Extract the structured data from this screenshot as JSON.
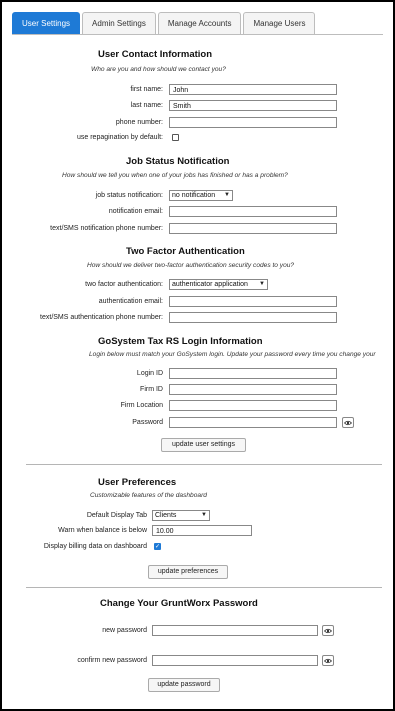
{
  "tabs": [
    {
      "label": "User Settings",
      "active": true
    },
    {
      "label": "Admin Settings",
      "active": false
    },
    {
      "label": "Manage Accounts",
      "active": false
    },
    {
      "label": "Manage Users",
      "active": false
    }
  ],
  "contact": {
    "title": "User Contact Information",
    "subtitle": "Who are you and how should we contact you?",
    "first_name_label": "first name:",
    "first_name_value": "John",
    "last_name_label": "last name:",
    "last_name_value": "Smith",
    "phone_label": "phone number:",
    "phone_value": "",
    "repagination_label": "use repagination by default:",
    "repagination_checked": false
  },
  "job_status": {
    "title": "Job Status Notification",
    "subtitle": "How should we tell you when one of your jobs has finished or has a problem?",
    "notification_label": "job status notification:",
    "notification_value": "no notification",
    "email_label": "notification email:",
    "email_value": "",
    "sms_label": "text/SMS notification phone number:",
    "sms_value": ""
  },
  "two_factor": {
    "title": "Two Factor Authentication",
    "subtitle": "How should we deliver two-factor authentication security codes to you?",
    "method_label": "two factor authentication:",
    "method_value": "authenticator application",
    "email_label": "authentication email:",
    "email_value": "",
    "sms_label": "text/SMS authentication phone number:",
    "sms_value": ""
  },
  "gosystem": {
    "title": "GoSystem Tax RS Login Information",
    "subtitle": "Login below must match your GoSystem login. Update your password every time you change your",
    "login_id_label": "Login ID",
    "firm_id_label": "Firm ID",
    "firm_location_label": "Firm Location",
    "password_label": "Password",
    "update_button": "update user settings"
  },
  "preferences": {
    "title": "User Preferences",
    "subtitle": "Customizable features of the dashboard",
    "display_tab_label": "Default Display Tab",
    "display_tab_value": "Clients",
    "warn_label": "Warn when balance is below",
    "warn_value": "10.00",
    "billing_label": "Display billing data on dashboard",
    "billing_checked": true,
    "update_button": "update preferences"
  },
  "password": {
    "title": "Change Your GruntWorx Password",
    "new_label": "new password",
    "confirm_label": "confirm new password",
    "update_button": "update password"
  },
  "icons": {
    "eye": "eye-icon",
    "dropdown": "chevron-down-icon",
    "check": "checkmark-icon"
  },
  "colors": {
    "accent": "#1e7ad6",
    "border": "#888888"
  }
}
